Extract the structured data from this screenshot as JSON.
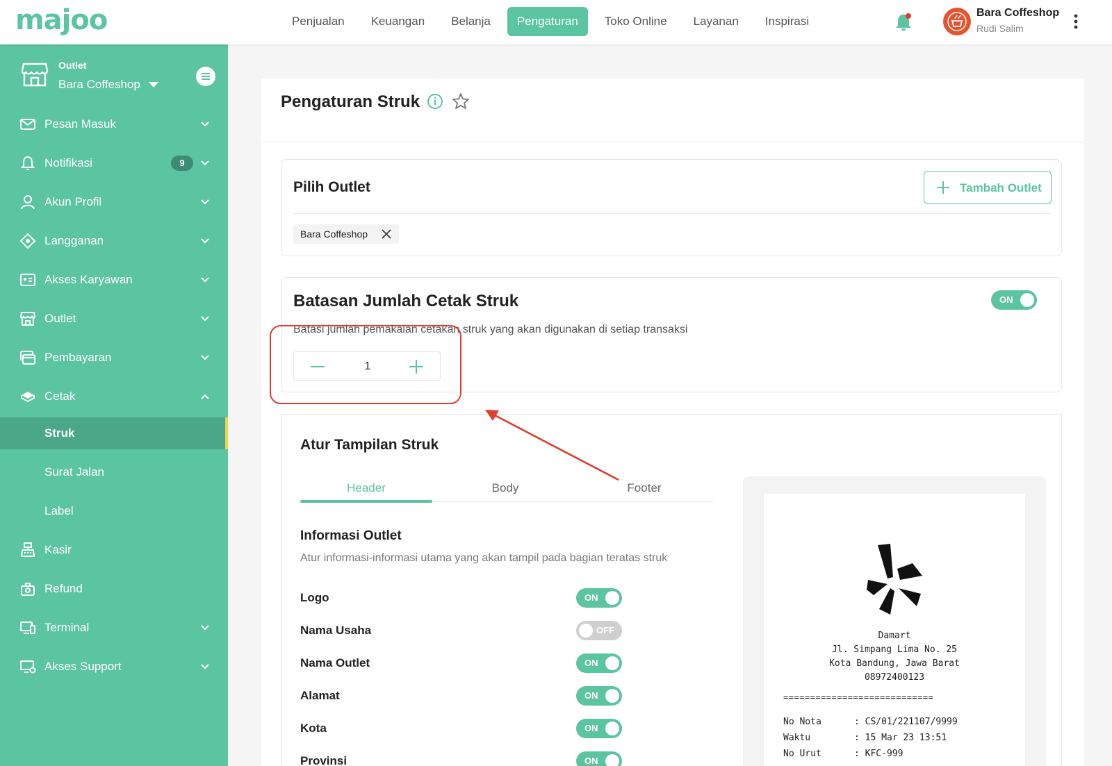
{
  "app": {
    "logo_text": "majoo"
  },
  "topnav": {
    "items": [
      "Penjualan",
      "Keuangan",
      "Belanja",
      "Pengaturan",
      "Toko Online",
      "Layanan",
      "Inspirasi"
    ],
    "active": "Pengaturan"
  },
  "user": {
    "name": "Bara Coffeshop",
    "sub": "Rudi Salim"
  },
  "sidebar": {
    "outlet_label": "Outlet",
    "outlet_name": "Bara Coffeshop",
    "items": [
      {
        "label": "Pesan Masuk",
        "icon": "mail-icon"
      },
      {
        "label": "Notifikasi",
        "icon": "bell-icon",
        "badge": "9"
      },
      {
        "label": "Akun Profil",
        "icon": "user-icon"
      },
      {
        "label": "Langganan",
        "icon": "diamond-icon"
      },
      {
        "label": "Akses Karyawan",
        "icon": "id-card-icon"
      },
      {
        "label": "Outlet",
        "icon": "store-icon"
      },
      {
        "label": "Pembayaran",
        "icon": "card-icon"
      },
      {
        "label": "Cetak",
        "icon": "printer-icon"
      }
    ],
    "cetak_sub": [
      "Struk",
      "Surat Jalan",
      "Label"
    ],
    "items_after": [
      {
        "label": "Kasir",
        "icon": "cashier-icon"
      },
      {
        "label": "Refund",
        "icon": "refund-icon"
      },
      {
        "label": "Terminal",
        "icon": "terminal-icon"
      },
      {
        "label": "Akses Support",
        "icon": "support-icon"
      }
    ]
  },
  "page": {
    "title": "Pengaturan Struk"
  },
  "pilih_outlet": {
    "title": "Pilih Outlet",
    "add_button": "Tambah Outlet",
    "selected_chip": "Bara Coffeshop"
  },
  "batasan": {
    "title": "Batasan Jumlah Cetak Struk",
    "toggle": "ON",
    "description": "Batasi jumlah pemakaian cetakan struk yang akan digunakan di setiap transaksi",
    "value": "1"
  },
  "atur_tampilan": {
    "title": "Atur Tampilan Struk",
    "tabs": [
      "Header",
      "Body",
      "Footer"
    ],
    "active_tab": "Header",
    "section_title": "Informasi Outlet",
    "section_desc": "Atur informasi-informasi utama yang akan tampil pada bagian teratas struk",
    "rows": [
      {
        "label": "Logo",
        "state": "ON"
      },
      {
        "label": "Nama Usaha",
        "state": "OFF"
      },
      {
        "label": "Nama Outlet",
        "state": "ON"
      },
      {
        "label": "Alamat",
        "state": "ON"
      },
      {
        "label": "Kota",
        "state": "ON"
      },
      {
        "label": "Provinsi",
        "state": "ON"
      }
    ]
  },
  "receipt": {
    "business": "Damart",
    "address": "Jl. Simpang Lima No. 25",
    "city": "Kota Bandung, Jawa Barat",
    "phone": "08972400123",
    "divider": "============================",
    "fields": [
      {
        "key": "No Nota",
        "value": ": CS/01/221107/9999"
      },
      {
        "key": "Waktu",
        "value": ": 15 Mar 23 13:51"
      },
      {
        "key": "No Urut",
        "value": ": KFC-999"
      }
    ]
  },
  "colors": {
    "accent": "#5bc4a1",
    "callout": "#e33b2e",
    "badge": "#3d8b72"
  }
}
